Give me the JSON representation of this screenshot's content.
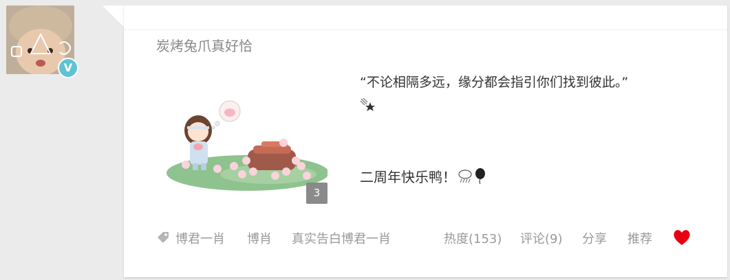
{
  "user": {
    "name": "炭烤兔爪真好恰",
    "verified_badge": "V",
    "avatar_icon": "child-photo-avatar"
  },
  "post": {
    "quote": "“不论相隔多远，缘分都会指引你们找到彼此。”",
    "line2_emoji": "falling-star-emoji",
    "anniversary": "二周年快乐鸭！",
    "anniversary_emojis": [
      "rain-cloud-emoji",
      "balloon-emoji"
    ],
    "image_count": "3"
  },
  "tags": [
    "博君一肖",
    "博肖",
    "真实告白博君一肖"
  ],
  "actions": {
    "hot": "热度(153)",
    "comment": "评论(9)",
    "share": "分享",
    "recommend": "推荐"
  },
  "colors": {
    "page_bg": "#ebebeb",
    "card_bg": "#ffffff",
    "muted_text": "#999999",
    "heart": "#e60012",
    "badge": "#5fc3d4"
  }
}
